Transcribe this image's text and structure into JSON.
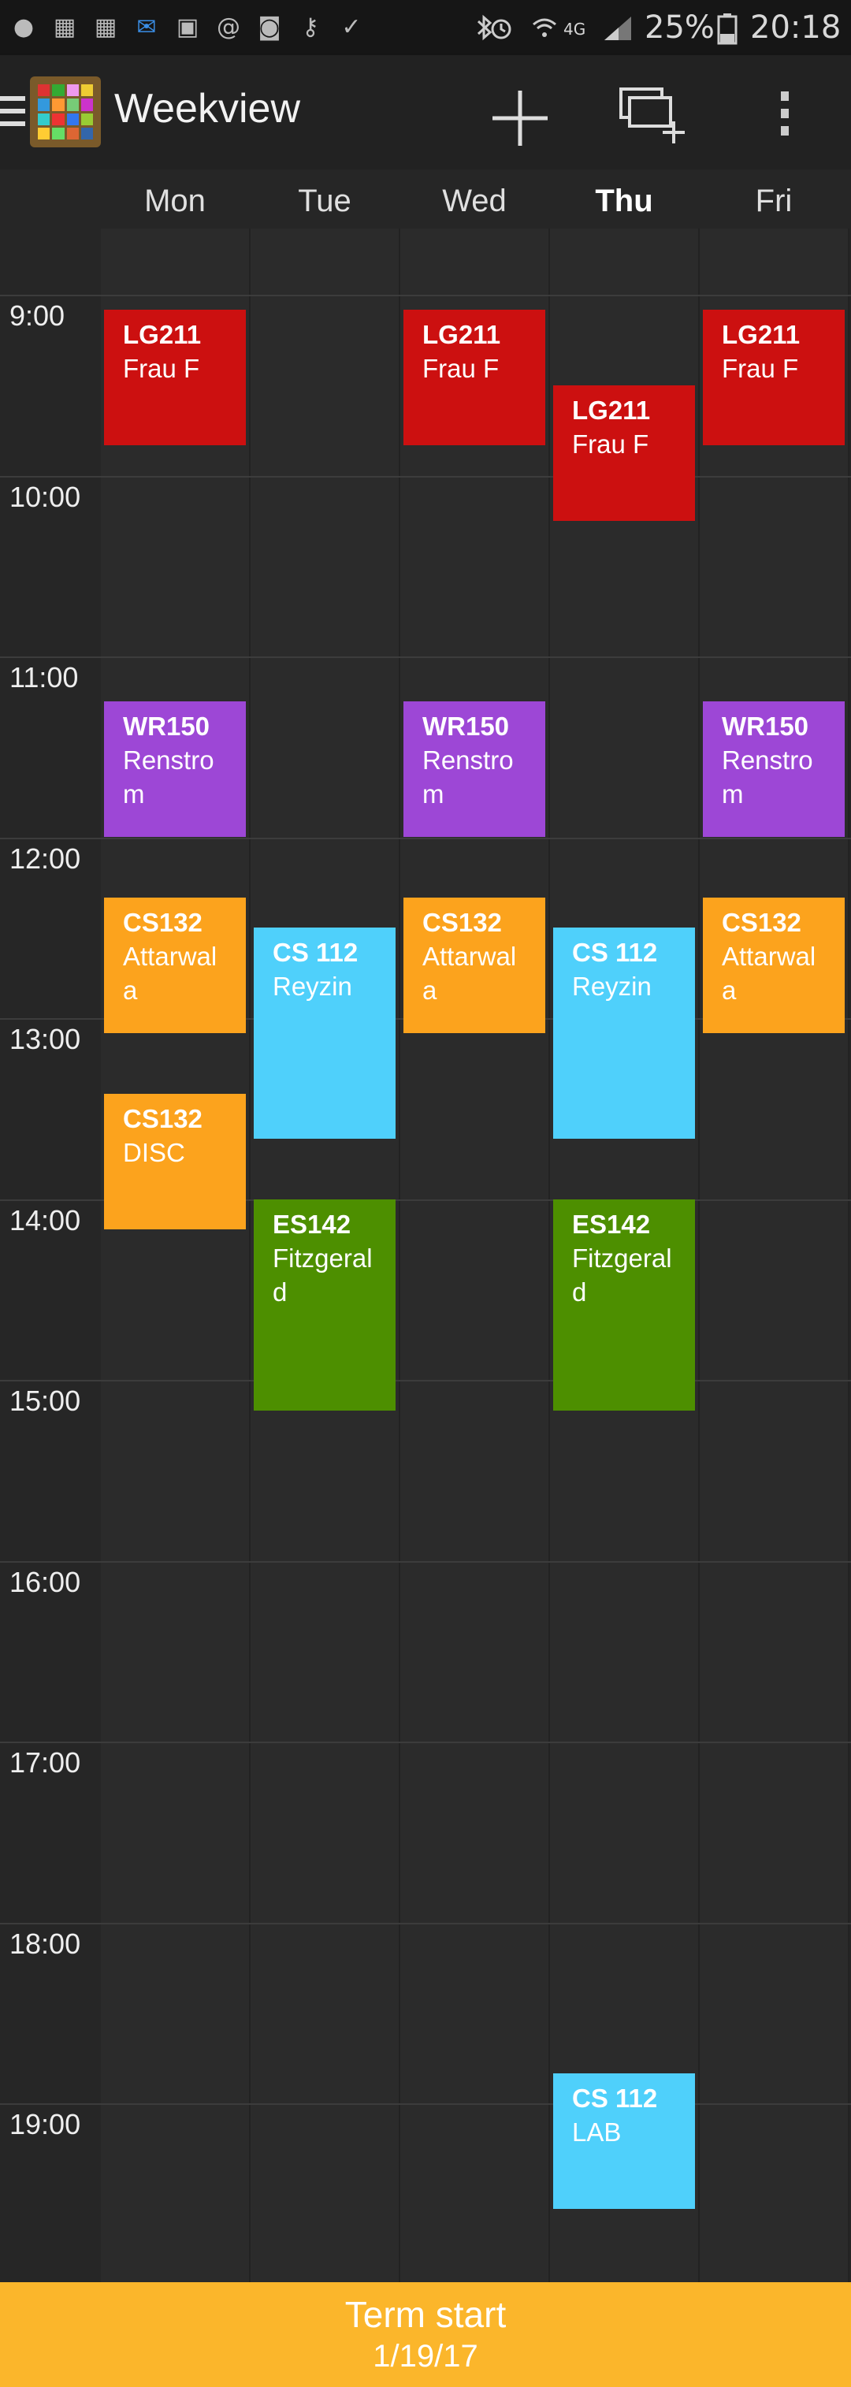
{
  "status_bar": {
    "battery": "25%",
    "time": "20:18",
    "network": "4G",
    "icons": [
      "notification-icon",
      "calendar-icon",
      "calendar-icon",
      "mail-icon",
      "image-icon",
      "at-icon",
      "camera-icon",
      "key-icon",
      "clipboard-icon",
      "bluetooth-icon",
      "alarm-icon",
      "wifi-icon",
      "signal-icon",
      "battery-icon"
    ]
  },
  "action_bar": {
    "title": "Weekview",
    "buttons": [
      "add-icon",
      "new-event-icon",
      "overflow-menu-icon"
    ]
  },
  "days": [
    {
      "label": "Mon",
      "today": false
    },
    {
      "label": "Tue",
      "today": false
    },
    {
      "label": "Wed",
      "today": false
    },
    {
      "label": "Thu",
      "today": true
    },
    {
      "label": "Fri",
      "today": false
    }
  ],
  "hours": [
    "9:00",
    "10:00",
    "11:00",
    "12:00",
    "13:00",
    "14:00",
    "15:00",
    "16:00",
    "17:00",
    "18:00",
    "19:00"
  ],
  "colors": {
    "red": "#cc1010",
    "purple": "#9d47d6",
    "orange": "#fca31d",
    "blue": "#4fd0fb",
    "green": "#4d8f00",
    "bottom_bar": "#fbb62b"
  },
  "events": [
    {
      "day": 0,
      "start": "9:05",
      "end": "9:50",
      "title": "LG211",
      "subtitle": "Frau F",
      "color": "red"
    },
    {
      "day": 2,
      "start": "9:05",
      "end": "9:50",
      "title": "LG211",
      "subtitle": "Frau F",
      "color": "red"
    },
    {
      "day": 4,
      "start": "9:05",
      "end": "9:50",
      "title": "LG211",
      "subtitle": "Frau F",
      "color": "red"
    },
    {
      "day": 3,
      "start": "9:30",
      "end": "10:15",
      "title": "LG211",
      "subtitle": "Frau F",
      "color": "red"
    },
    {
      "day": 0,
      "start": "11:15",
      "end": "12:00",
      "title": "WR150",
      "subtitle": "Renstrom",
      "color": "purple"
    },
    {
      "day": 2,
      "start": "11:15",
      "end": "12:00",
      "title": "WR150",
      "subtitle": "Renstrom",
      "color": "purple"
    },
    {
      "day": 4,
      "start": "11:15",
      "end": "12:00",
      "title": "WR150",
      "subtitle": "Renstrom",
      "color": "purple"
    },
    {
      "day": 0,
      "start": "12:20",
      "end": "13:05",
      "title": "CS132",
      "subtitle": "Attarwala",
      "color": "orange"
    },
    {
      "day": 2,
      "start": "12:20",
      "end": "13:05",
      "title": "CS132",
      "subtitle": "Attarwala",
      "color": "orange"
    },
    {
      "day": 4,
      "start": "12:20",
      "end": "13:05",
      "title": "CS132",
      "subtitle": "Attarwala",
      "color": "orange"
    },
    {
      "day": 1,
      "start": "12:30",
      "end": "13:40",
      "title": "CS 112",
      "subtitle": "Reyzin",
      "color": "blue"
    },
    {
      "day": 3,
      "start": "12:30",
      "end": "13:40",
      "title": "CS 112",
      "subtitle": "Reyzin",
      "color": "blue"
    },
    {
      "day": 0,
      "start": "13:25",
      "end": "14:10",
      "title": "CS132",
      "subtitle": "DISC",
      "color": "orange"
    },
    {
      "day": 1,
      "start": "14:00",
      "end": "15:10",
      "title": "ES142",
      "subtitle": "Fitzgerald",
      "color": "green"
    },
    {
      "day": 3,
      "start": "14:00",
      "end": "15:10",
      "title": "ES142",
      "subtitle": "Fitzgerald",
      "color": "green"
    },
    {
      "day": 3,
      "start": "18:50",
      "end": "19:35",
      "title": "CS 112",
      "subtitle": "LAB",
      "color": "blue"
    }
  ],
  "bottom_bar": {
    "line1": "Term start",
    "line2": "1/19/17"
  }
}
